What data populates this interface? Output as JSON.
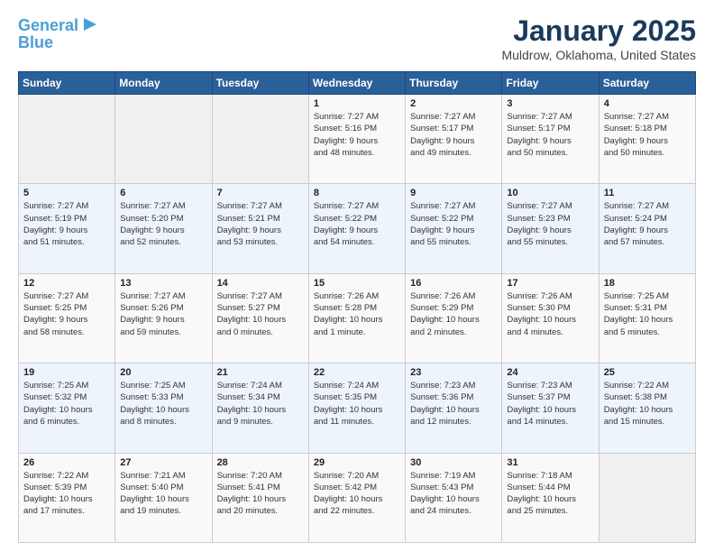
{
  "header": {
    "logo_line1": "General",
    "logo_line2": "Blue",
    "title": "January 2025",
    "subtitle": "Muldrow, Oklahoma, United States"
  },
  "weekdays": [
    "Sunday",
    "Monday",
    "Tuesday",
    "Wednesday",
    "Thursday",
    "Friday",
    "Saturday"
  ],
  "weeks": [
    [
      {
        "day": "",
        "info": ""
      },
      {
        "day": "",
        "info": ""
      },
      {
        "day": "",
        "info": ""
      },
      {
        "day": "1",
        "info": "Sunrise: 7:27 AM\nSunset: 5:16 PM\nDaylight: 9 hours\nand 48 minutes."
      },
      {
        "day": "2",
        "info": "Sunrise: 7:27 AM\nSunset: 5:17 PM\nDaylight: 9 hours\nand 49 minutes."
      },
      {
        "day": "3",
        "info": "Sunrise: 7:27 AM\nSunset: 5:17 PM\nDaylight: 9 hours\nand 50 minutes."
      },
      {
        "day": "4",
        "info": "Sunrise: 7:27 AM\nSunset: 5:18 PM\nDaylight: 9 hours\nand 50 minutes."
      }
    ],
    [
      {
        "day": "5",
        "info": "Sunrise: 7:27 AM\nSunset: 5:19 PM\nDaylight: 9 hours\nand 51 minutes."
      },
      {
        "day": "6",
        "info": "Sunrise: 7:27 AM\nSunset: 5:20 PM\nDaylight: 9 hours\nand 52 minutes."
      },
      {
        "day": "7",
        "info": "Sunrise: 7:27 AM\nSunset: 5:21 PM\nDaylight: 9 hours\nand 53 minutes."
      },
      {
        "day": "8",
        "info": "Sunrise: 7:27 AM\nSunset: 5:22 PM\nDaylight: 9 hours\nand 54 minutes."
      },
      {
        "day": "9",
        "info": "Sunrise: 7:27 AM\nSunset: 5:22 PM\nDaylight: 9 hours\nand 55 minutes."
      },
      {
        "day": "10",
        "info": "Sunrise: 7:27 AM\nSunset: 5:23 PM\nDaylight: 9 hours\nand 55 minutes."
      },
      {
        "day": "11",
        "info": "Sunrise: 7:27 AM\nSunset: 5:24 PM\nDaylight: 9 hours\nand 57 minutes."
      }
    ],
    [
      {
        "day": "12",
        "info": "Sunrise: 7:27 AM\nSunset: 5:25 PM\nDaylight: 9 hours\nand 58 minutes."
      },
      {
        "day": "13",
        "info": "Sunrise: 7:27 AM\nSunset: 5:26 PM\nDaylight: 9 hours\nand 59 minutes."
      },
      {
        "day": "14",
        "info": "Sunrise: 7:27 AM\nSunset: 5:27 PM\nDaylight: 10 hours\nand 0 minutes."
      },
      {
        "day": "15",
        "info": "Sunrise: 7:26 AM\nSunset: 5:28 PM\nDaylight: 10 hours\nand 1 minute."
      },
      {
        "day": "16",
        "info": "Sunrise: 7:26 AM\nSunset: 5:29 PM\nDaylight: 10 hours\nand 2 minutes."
      },
      {
        "day": "17",
        "info": "Sunrise: 7:26 AM\nSunset: 5:30 PM\nDaylight: 10 hours\nand 4 minutes."
      },
      {
        "day": "18",
        "info": "Sunrise: 7:25 AM\nSunset: 5:31 PM\nDaylight: 10 hours\nand 5 minutes."
      }
    ],
    [
      {
        "day": "19",
        "info": "Sunrise: 7:25 AM\nSunset: 5:32 PM\nDaylight: 10 hours\nand 6 minutes."
      },
      {
        "day": "20",
        "info": "Sunrise: 7:25 AM\nSunset: 5:33 PM\nDaylight: 10 hours\nand 8 minutes."
      },
      {
        "day": "21",
        "info": "Sunrise: 7:24 AM\nSunset: 5:34 PM\nDaylight: 10 hours\nand 9 minutes."
      },
      {
        "day": "22",
        "info": "Sunrise: 7:24 AM\nSunset: 5:35 PM\nDaylight: 10 hours\nand 11 minutes."
      },
      {
        "day": "23",
        "info": "Sunrise: 7:23 AM\nSunset: 5:36 PM\nDaylight: 10 hours\nand 12 minutes."
      },
      {
        "day": "24",
        "info": "Sunrise: 7:23 AM\nSunset: 5:37 PM\nDaylight: 10 hours\nand 14 minutes."
      },
      {
        "day": "25",
        "info": "Sunrise: 7:22 AM\nSunset: 5:38 PM\nDaylight: 10 hours\nand 15 minutes."
      }
    ],
    [
      {
        "day": "26",
        "info": "Sunrise: 7:22 AM\nSunset: 5:39 PM\nDaylight: 10 hours\nand 17 minutes."
      },
      {
        "day": "27",
        "info": "Sunrise: 7:21 AM\nSunset: 5:40 PM\nDaylight: 10 hours\nand 19 minutes."
      },
      {
        "day": "28",
        "info": "Sunrise: 7:20 AM\nSunset: 5:41 PM\nDaylight: 10 hours\nand 20 minutes."
      },
      {
        "day": "29",
        "info": "Sunrise: 7:20 AM\nSunset: 5:42 PM\nDaylight: 10 hours\nand 22 minutes."
      },
      {
        "day": "30",
        "info": "Sunrise: 7:19 AM\nSunset: 5:43 PM\nDaylight: 10 hours\nand 24 minutes."
      },
      {
        "day": "31",
        "info": "Sunrise: 7:18 AM\nSunset: 5:44 PM\nDaylight: 10 hours\nand 25 minutes."
      },
      {
        "day": "",
        "info": ""
      }
    ]
  ]
}
